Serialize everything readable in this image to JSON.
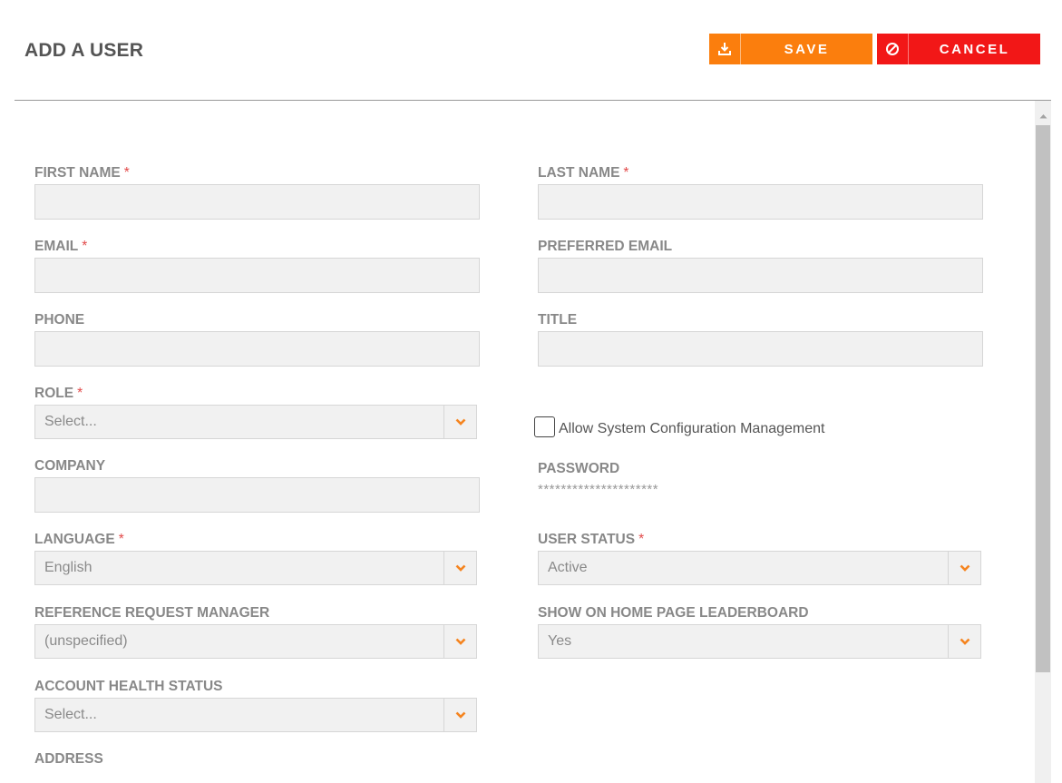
{
  "header": {
    "title": "ADD A USER",
    "save_label": "SAVE",
    "cancel_label": "CANCEL",
    "save_icon": "download-icon",
    "cancel_icon": "ban-icon"
  },
  "colors": {
    "save": "#fb7e0d",
    "cancel": "#f21717",
    "chevron": "#f5841f",
    "required": "#e24a4a"
  },
  "form": {
    "required_marker": "*",
    "first_name": {
      "label": "FIRST NAME",
      "value": ""
    },
    "last_name": {
      "label": "LAST NAME",
      "value": ""
    },
    "email": {
      "label": "EMAIL",
      "value": ""
    },
    "preferred_email": {
      "label": "PREFERRED EMAIL",
      "value": ""
    },
    "phone": {
      "label": "PHONE",
      "value": ""
    },
    "title": {
      "label": "TITLE",
      "value": ""
    },
    "role": {
      "label": "ROLE",
      "value": "Select..."
    },
    "allow_config": {
      "label": "Allow System Configuration Management",
      "checked": false
    },
    "company": {
      "label": "COMPANY",
      "value": ""
    },
    "password": {
      "label": "PASSWORD",
      "value": "*********************"
    },
    "language": {
      "label": "LANGUAGE",
      "value": "English"
    },
    "user_status": {
      "label": "USER STATUS",
      "value": "Active"
    },
    "reference_request_manager": {
      "label": "REFERENCE REQUEST MANAGER",
      "value": "(unspecified)"
    },
    "show_on_leaderboard": {
      "label": "SHOW ON HOME PAGE LEADERBOARD",
      "value": "Yes"
    },
    "account_health_status": {
      "label": "ACCOUNT HEALTH STATUS",
      "value": "Select..."
    },
    "address": {
      "label": "ADDRESS"
    }
  }
}
